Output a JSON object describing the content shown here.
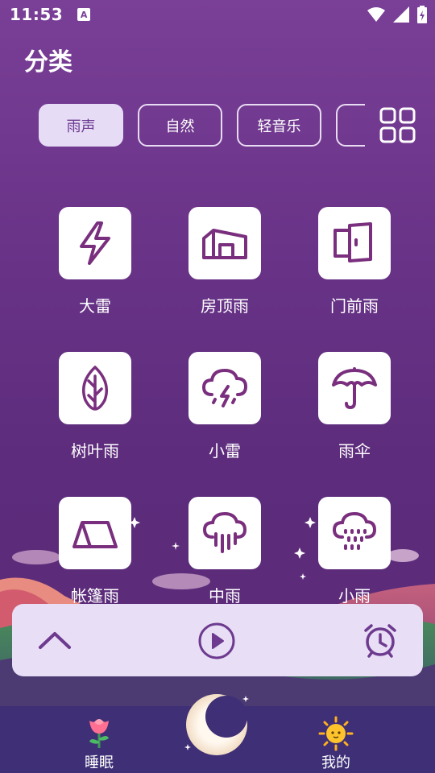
{
  "status_bar": {
    "time": "11:53",
    "notification_badge": "A"
  },
  "page": {
    "title": "分类"
  },
  "tabs": [
    {
      "label": "雨声",
      "active": true
    },
    {
      "label": "自然",
      "active": false
    },
    {
      "label": "轻音乐",
      "active": false
    },
    {
      "label": "",
      "active": false
    }
  ],
  "sounds": [
    {
      "label": "大雷",
      "icon": "lightning-icon"
    },
    {
      "label": "房顶雨",
      "icon": "rooftop-icon"
    },
    {
      "label": "门前雨",
      "icon": "door-icon"
    },
    {
      "label": "树叶雨",
      "icon": "leaf-icon"
    },
    {
      "label": "小雷",
      "icon": "thunder-cloud-icon"
    },
    {
      "label": "雨伞",
      "icon": "umbrella-icon"
    },
    {
      "label": "帐篷雨",
      "icon": "tent-icon"
    },
    {
      "label": "中雨",
      "icon": "rain-cloud-icon"
    },
    {
      "label": "小雨",
      "icon": "drizzle-cloud-icon"
    }
  ],
  "bottom_nav": [
    {
      "label": "睡眠",
      "icon": "rose-icon"
    },
    {
      "label": "我的",
      "icon": "sun-face-icon"
    }
  ],
  "colors": {
    "accent": "#6d3a8f",
    "nav_bg": "#3e2f76",
    "player_bg": "#e8def5"
  }
}
